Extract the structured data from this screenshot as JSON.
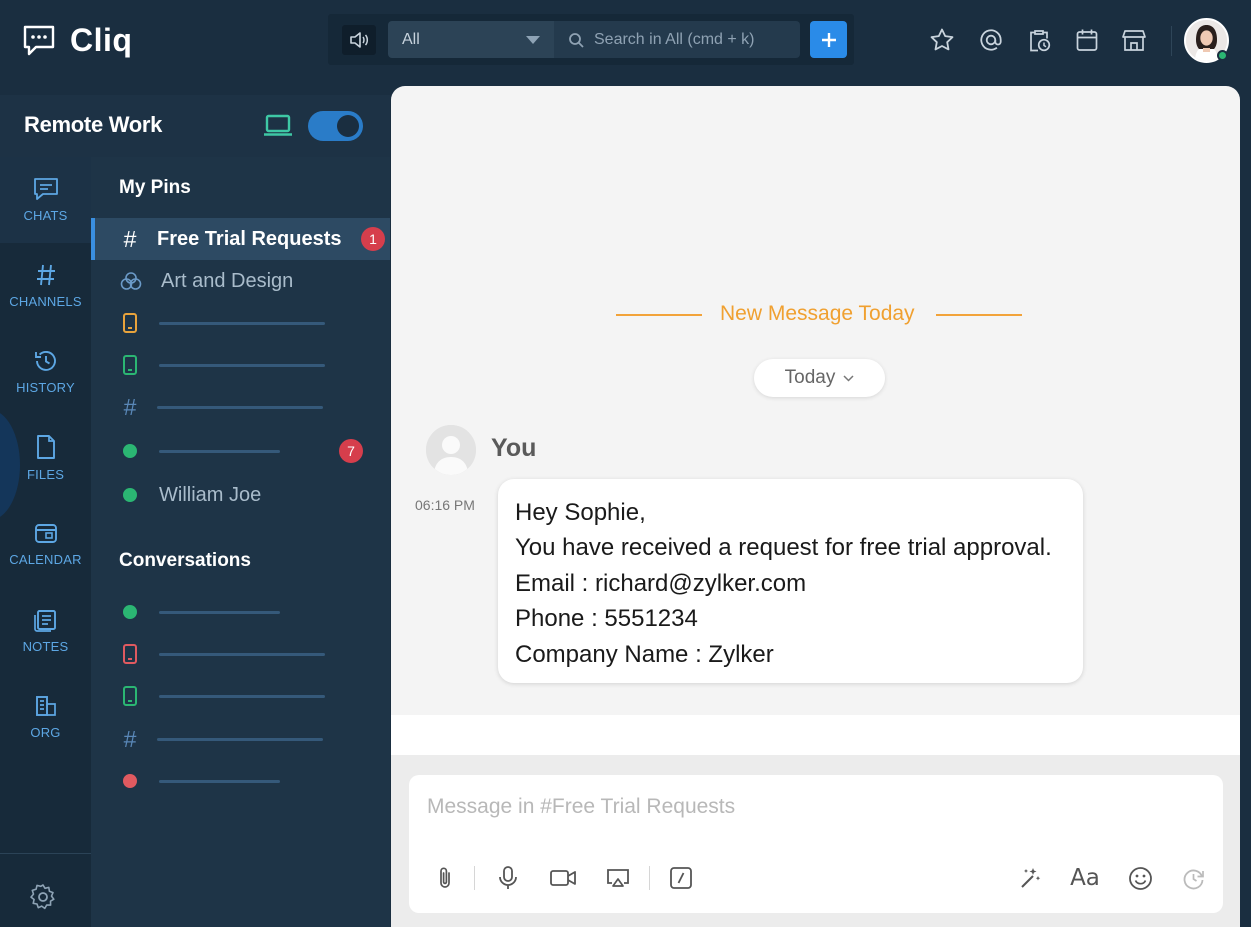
{
  "app": {
    "name": "Cliq"
  },
  "search": {
    "scope": "All",
    "placeholder": "Search in All (cmd + k)"
  },
  "topbar": {
    "icons": [
      "speaker-icon",
      "plus-icon",
      "star-icon",
      "at-icon",
      "clipboard-clock-icon",
      "calendar-icon",
      "store-icon"
    ]
  },
  "workspace": {
    "title": "Remote Work",
    "toggle_on": true
  },
  "rail": {
    "items": [
      {
        "label": "CHATS",
        "icon": "chat-icon",
        "active": true
      },
      {
        "label": "CHANNELS",
        "icon": "hash-icon"
      },
      {
        "label": "HISTORY",
        "icon": "history-icon"
      },
      {
        "label": "FILES",
        "icon": "file-icon"
      },
      {
        "label": "CALENDAR",
        "icon": "calendar-icon"
      },
      {
        "label": "NOTES",
        "icon": "notes-icon"
      },
      {
        "label": "ORG",
        "icon": "org-icon"
      }
    ]
  },
  "pins": {
    "title": "My Pins",
    "items": [
      {
        "name": "Free Trial Requests",
        "type": "channel",
        "badge": "1",
        "active": true
      },
      {
        "name": "Art and Design",
        "type": "group"
      },
      {
        "name": "",
        "type": "phone",
        "color": "#e8a33c"
      },
      {
        "name": "",
        "type": "phone",
        "color": "#2bb673"
      },
      {
        "name": "",
        "type": "channel"
      },
      {
        "name": "",
        "type": "user",
        "color": "#2bb673",
        "badge": "7"
      },
      {
        "name": "William Joe",
        "type": "user",
        "color": "#2bb673"
      }
    ]
  },
  "conversations": {
    "title": "Conversations",
    "items": [
      {
        "type": "user",
        "color": "#2bb673"
      },
      {
        "type": "phone",
        "color": "#e05a60"
      },
      {
        "type": "phone",
        "color": "#2bb673"
      },
      {
        "type": "channel"
      },
      {
        "type": "user",
        "color": "#e05a60"
      }
    ]
  },
  "chat": {
    "new_message_label": "New Message Today",
    "date_pill": "Today",
    "sender": "You",
    "time": "06:16 PM",
    "message_lines": [
      "Hey Sophie,",
      "You have received a request for free trial approval.",
      "Email : richard@zylker.com",
      "Phone : 5551234",
      "Company Name : Zylker"
    ]
  },
  "composer": {
    "placeholder": "Message in #Free Trial Requests",
    "tools": [
      "paperclip-icon",
      "microphone-icon",
      "video-icon",
      "screen-share-icon",
      "slash-command-icon",
      "magic-wand-icon",
      "text-format-icon",
      "emoji-icon",
      "schedule-icon"
    ],
    "format_label": "Aa"
  },
  "colors": {
    "accent": "#2a8be8",
    "badge": "#d63e4c",
    "new_message": "#f0a030",
    "online": "#2bb673"
  }
}
